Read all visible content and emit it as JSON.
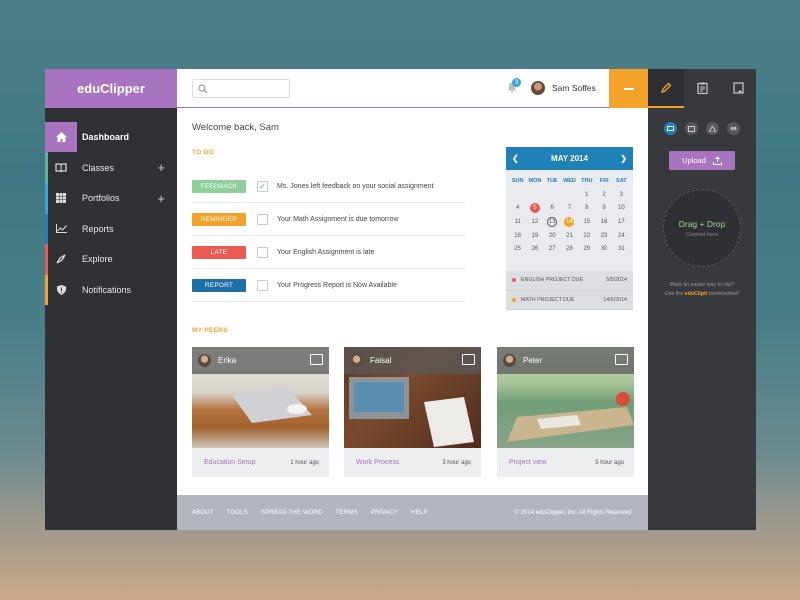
{
  "app": {
    "logo": "eduClipper"
  },
  "sidebar": {
    "items": [
      {
        "label": "Dashboard",
        "icon": "home-icon",
        "color": "#a874c0",
        "active": true
      },
      {
        "label": "Classes",
        "icon": "book-icon",
        "color": "#5fb3a4",
        "plus": "+"
      },
      {
        "label": "Portfolios",
        "icon": "grid-icon",
        "color": "#3aa6d9",
        "plus": "+"
      },
      {
        "label": "Reports",
        "icon": "chart-icon",
        "color": "#1e82b8"
      },
      {
        "label": "Explore",
        "icon": "compass-icon",
        "color": "#e95a52"
      },
      {
        "label": "Notifications",
        "icon": "shield-icon",
        "color": "#f4a32a"
      }
    ]
  },
  "topbar": {
    "search_placeholder": "",
    "notification_count": "3",
    "user_name": "Sam Soffes"
  },
  "main": {
    "welcome": "Welcome back, Sam",
    "todo_title": "TO DO",
    "todos": [
      {
        "tag": "FEEDBACK",
        "tag_color": "#8fcf9a",
        "text": "Ms. Jones left feedback on your social assignment",
        "checked": true
      },
      {
        "tag": "REMINDER",
        "tag_color": "#f4a32a",
        "text": "Your Math Assignment is due tomorrow",
        "checked": false
      },
      {
        "tag": "LATE",
        "tag_color": "#e95a52",
        "text": "Your English Assignment is late",
        "checked": false
      },
      {
        "tag": "REPORT",
        "tag_color": "#1e6fa8",
        "text": "Your Progress Report is Now Available",
        "checked": false
      }
    ],
    "peers_title": "MY PEERS",
    "peers": [
      {
        "name": "Erika",
        "link": "Education Setup",
        "time": "1 hour ago"
      },
      {
        "name": "Faisal",
        "link": "Work Process",
        "time": "3 hour ago"
      },
      {
        "name": "Peter",
        "link": "Project view",
        "time": "5 hour ago"
      }
    ]
  },
  "calendar": {
    "month": "MAY 2014",
    "dow": [
      "SUN",
      "MON",
      "TUE",
      "WED",
      "THU",
      "FRI",
      "SAT"
    ],
    "days": [
      "",
      "",
      "",
      "",
      "1",
      "2",
      "3",
      "4",
      "5",
      "6",
      "7",
      "8",
      "9",
      "10",
      "11",
      "12",
      "13",
      "14",
      "15",
      "16",
      "17",
      "18",
      "19",
      "20",
      "21",
      "22",
      "23",
      "24",
      "25",
      "26",
      "27",
      "28",
      "29",
      "30",
      "31"
    ],
    "events": [
      {
        "label": "ENGLISH PROJECT DUE",
        "date": "5/5/2014",
        "color": "#e95a52"
      },
      {
        "label": "MATH PROJECT DUE",
        "date": "14/5/2014",
        "color": "#f4a32a"
      }
    ]
  },
  "footer": {
    "links": [
      "ABOUT",
      "TOOLS",
      "SPREAD THE WORD",
      "TERMS",
      "PRIVACY",
      "HELP"
    ],
    "copyright": "© 2014 eduClipper, Inc. All Rights Reserved."
  },
  "right_panel": {
    "upload": "Upload",
    "drop_title": "Drag + Drop",
    "drop_sub": "Content here",
    "hint_line1": "Want an easier way to clip?",
    "hint_pre": "Use the ",
    "hint_link": "eduClipit",
    "hint_post": " bookmarklet!"
  }
}
